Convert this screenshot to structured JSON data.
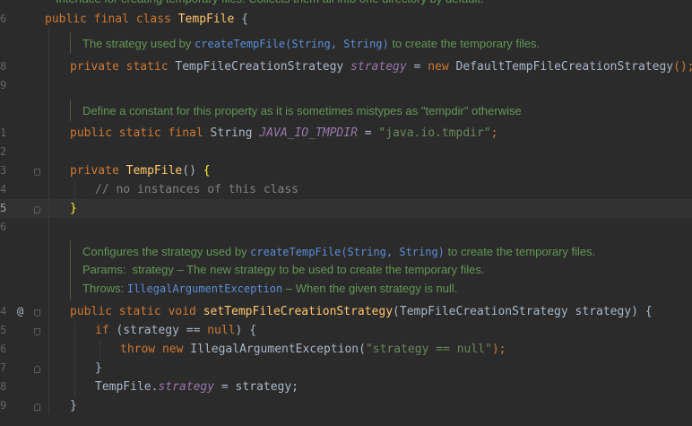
{
  "editor": {
    "line_numbers": [
      "6",
      "8",
      "9",
      "1",
      "2",
      "3",
      "4",
      "5",
      "6",
      "4",
      "5",
      "6",
      "7",
      "8",
      "9"
    ],
    "top_doc": "Interface for creating temporary files. Collects them all into one directory by default.",
    "lines": {
      "class_decl": {
        "kw1": "public final class ",
        "name": "TempFile",
        "rest": " {"
      },
      "doc1": {
        "pre": "The strategy used by ",
        "link": "createTempFile(String, String)",
        "post": " to create the temporary files."
      },
      "field1": {
        "kw": "private static ",
        "type": "TempFileCreationStrategy ",
        "name": "strategy",
        "eq": " = ",
        "new": "new ",
        "cls": "DefaultTempFileCreationStrategy",
        "end": "();"
      },
      "doc2": {
        "text": "Define a constant for this property as it is sometimes mistypes as \"tempdir\" otherwise"
      },
      "field2": {
        "kw": "public static final ",
        "type": "String ",
        "name": "JAVA_IO_TMPDIR",
        "eq": " = ",
        "str": "\"java.io.tmpdir\"",
        "end": ";"
      },
      "ctor": {
        "kw": "private ",
        "name": "TempFile",
        "paren": "() ",
        "brace": "{"
      },
      "ctor_comment": "// no instances of this class",
      "ctor_close": "}",
      "doc3a": {
        "pre": "Configures the strategy used by ",
        "link": "createTempFile(String, String)",
        "post": " to create the temporary files."
      },
      "doc3b": {
        "text": "Params:  strategy – The new strategy to be used to create the temporary files."
      },
      "doc3c": {
        "pre": "Throws: ",
        "link": "IllegalArgumentException",
        "post": " – When the given strategy is null."
      },
      "setter": {
        "kw": "public static void ",
        "name": "setTempFileCreationStrategy",
        "params": "(TempFileCreationStrategy strategy) {"
      },
      "if": {
        "kw": "if ",
        "cond": "(strategy == ",
        "null": "null",
        "rest": ") {"
      },
      "throw": {
        "kw": "throw new ",
        "cls": "IllegalArgumentException",
        "open": "(",
        "str": "\"strategy == null\"",
        "close": ");"
      },
      "if_close": "}",
      "assign": {
        "cls": "TempFile.",
        "fld": "strategy",
        "rest": " = strategy;"
      },
      "setter_close": "}"
    },
    "gutter_at": "@"
  }
}
